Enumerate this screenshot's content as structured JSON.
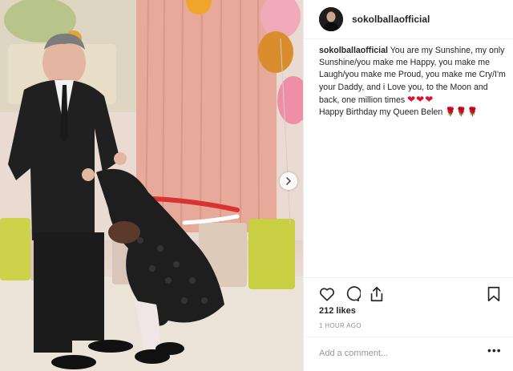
{
  "post": {
    "username": "sokolballaofficial",
    "caption_user": "sokolballaofficial",
    "caption_text": " You are my Sunshine, my only Sunshine/you make me Happy, you make me Laugh/you make me Proud, you make me Cry/I'm your Daddy, and i Love you, to the Moon and back, one million times ",
    "caption_hearts": "❤❤❤",
    "caption_line2": "Happy Birthday my Queen Belen ",
    "caption_roses": "🌹🌹🌹",
    "likes": "212 likes",
    "time_ago": "1 HOUR AGO",
    "comment_placeholder": "Add a comment...",
    "more_options": "•••"
  },
  "icons": {
    "like": "heart-icon",
    "comment": "comment-icon",
    "share": "share-icon",
    "save": "bookmark-icon",
    "next": "chevron-right-icon"
  },
  "colors": {
    "heart_emoji": "#e0102b",
    "muted_text": "#8e8e8e",
    "divider": "#efefef"
  }
}
